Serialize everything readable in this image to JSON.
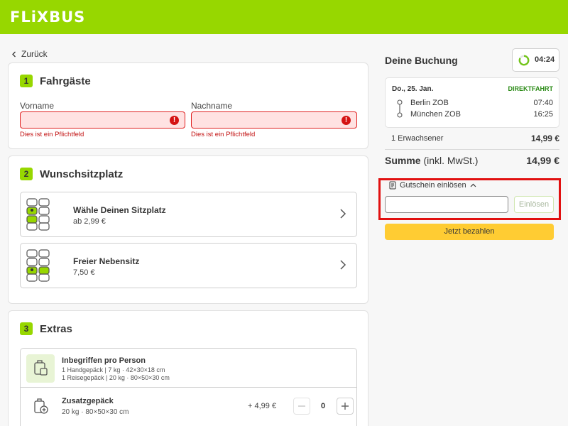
{
  "header": {
    "logo": "FLiXBUS"
  },
  "nav": {
    "back_label": "Zurück"
  },
  "section1": {
    "number": "1",
    "title": "Fahrgäste",
    "first_name_label": "Vorname",
    "last_name_label": "Nachname",
    "first_name_value": "",
    "last_name_value": "",
    "error_text": "Dies ist ein Pflichtfeld"
  },
  "section2": {
    "number": "2",
    "title": "Wunschsitzplatz",
    "options": [
      {
        "name": "Wähle Deinen Sitzplatz",
        "price": "ab 2,99 €"
      },
      {
        "name": "Freier Nebensitz",
        "price": "7,50 €"
      }
    ]
  },
  "section3": {
    "number": "3",
    "title": "Extras",
    "included": {
      "name": "Inbegriffen pro Person",
      "line1": "1 Handgepäck | 7 kg · 42×30×18 cm",
      "line2": "1 Reisegepäck | 20 kg · 80×50×30 cm"
    },
    "extra": {
      "name": "Zusatzgepäck",
      "sub": "20 kg · 80×50×30 cm",
      "price": "+ 4,99 €",
      "quantity": "0"
    }
  },
  "booking": {
    "title": "Deine Buchung",
    "timer": "04:24",
    "date": "Do., 25. Jan.",
    "direct": "DIREKTFAHRT",
    "from_city": "Berlin ZOB",
    "from_time": "07:40",
    "to_city": "München ZOB",
    "to_time": "16:25",
    "passenger_label": "1 Erwachsener",
    "passenger_price": "14,99 €",
    "sum_label": "Summe",
    "sum_note": "(inkl. MwSt.)",
    "sum_value": "14,99 €",
    "voucher_label": "Gutschein einlösen",
    "voucher_value": "",
    "voucher_button": "Einlösen",
    "pay_button": "Jetzt bezahlen"
  },
  "colors": {
    "brand_green": "#97d700",
    "error_red": "#e02020",
    "pay_yellow": "#ffcc33",
    "direct_green": "#2a8a15"
  }
}
